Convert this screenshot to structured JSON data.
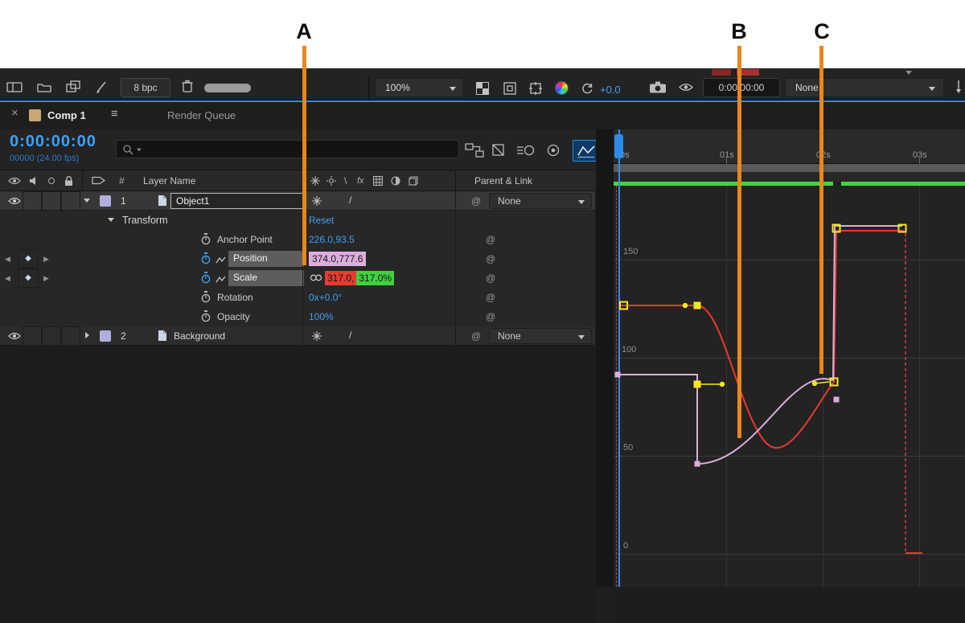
{
  "annotations": {
    "a": "A",
    "b": "B",
    "c": "C"
  },
  "toolbar": {
    "bit_depth": "8 bpc",
    "zoom_level": "100%",
    "exposure": "+0.0",
    "timecode": "0:00:00:00",
    "preset": "None"
  },
  "tabs": {
    "comp": "Comp 1",
    "render_queue": "Render Queue"
  },
  "timeline": {
    "timecode": "0:00:00:00",
    "frame_info": "00000 (24.00 fps)",
    "columns": {
      "hash": "#",
      "layer_name": "Layer Name",
      "parent_link": "Parent & Link"
    },
    "layer1": {
      "index": "1",
      "name": "Object1",
      "parent": "None"
    },
    "layer2": {
      "index": "2",
      "name": "Background",
      "parent": "None"
    },
    "transform": {
      "label": "Transform",
      "reset": "Reset",
      "anchor_label": "Anchor Point",
      "anchor_value": "226.0,93.5",
      "position_label": "Position",
      "position_value": "374.0,777.6",
      "scale_label": "Scale",
      "scale_x": "317.0,",
      "scale_y": "317.0%",
      "rotation_label": "Rotation",
      "rotation_value": "0x+0.0°",
      "opacity_label": "Opacity",
      "opacity_value": "100%"
    }
  },
  "graph": {
    "time_ticks": [
      "0s",
      "01s",
      "02s",
      "03s"
    ],
    "value_ticks": [
      "150",
      "100",
      "50",
      "0"
    ]
  }
}
